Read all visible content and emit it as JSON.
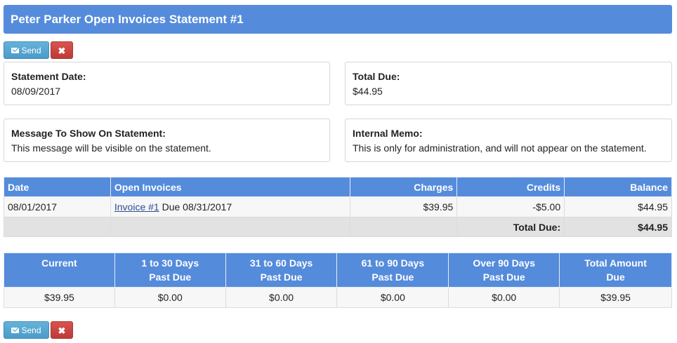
{
  "header": {
    "title": "Peter Parker Open Invoices Statement #1"
  },
  "actions": {
    "send_label": "Send",
    "close_label": "✖"
  },
  "statement_date": {
    "label": "Statement Date:",
    "value": "08/09/2017"
  },
  "total_due": {
    "label": "Total Due:",
    "value": "$44.95"
  },
  "message": {
    "label": "Message To Show On Statement:",
    "value": "This message will be visible on the statement."
  },
  "memo": {
    "label": "Internal Memo:",
    "value": "This is only for administration, and will not appear on the statement."
  },
  "invoices": {
    "headers": {
      "date": "Date",
      "open_invoices": "Open Invoices",
      "charges": "Charges",
      "credits": "Credits",
      "balance": "Balance"
    },
    "rows": [
      {
        "date": "08/01/2017",
        "invoice_link": "Invoice #1",
        "due": "Due 08/31/2017",
        "charges": "$39.95",
        "credits": "-$5.00",
        "balance": "$44.95"
      }
    ],
    "total_label": "Total Due:",
    "total_value": "$44.95"
  },
  "aging": {
    "headers": {
      "current": "Current",
      "d1_30_a": "1 to 30 Days",
      "d1_30_b": "Past Due",
      "d31_60_a": "31 to 60 Days",
      "d31_60_b": "Past Due",
      "d61_90_a": "61 to 90 Days",
      "d61_90_b": "Past Due",
      "d90_a": "Over 90 Days",
      "d90_b": "Past Due",
      "total_a": "Total Amount",
      "total_b": "Due"
    },
    "values": {
      "current": "$39.95",
      "d1_30": "$0.00",
      "d31_60": "$0.00",
      "d61_90": "$0.00",
      "d90": "$0.00",
      "total": "$39.95"
    }
  }
}
